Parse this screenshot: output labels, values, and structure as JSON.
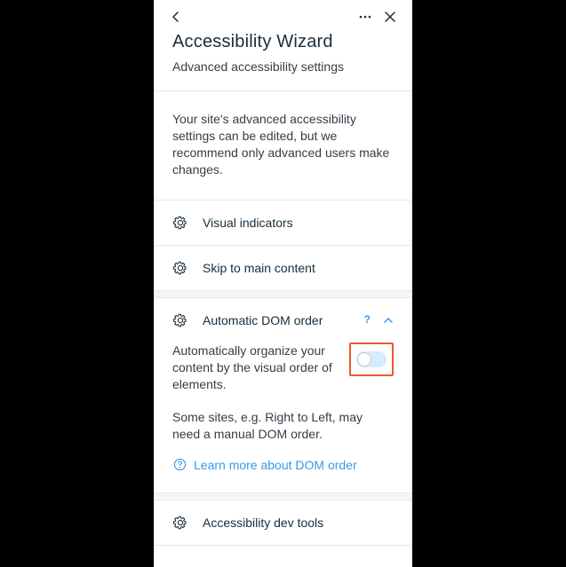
{
  "header": {
    "title": "Accessibility Wizard",
    "subtitle": "Advanced accessibility settings"
  },
  "intro": "Your site's advanced accessibility settings can be edited, but we recommend only advanced users make changes.",
  "rows": {
    "visual_indicators": "Visual indicators",
    "skip_to_main": "Skip to main content",
    "auto_dom_order": "Automatic DOM order",
    "a11y_dev_tools": "Accessibility dev tools"
  },
  "dom_order": {
    "help": "?",
    "description": "Automatically organize your content by the visual order of elements.",
    "note": "Some sites, e.g. Right to Left, may need a manual DOM order.",
    "learn_more": "Learn more about DOM order",
    "toggle_on": false
  }
}
